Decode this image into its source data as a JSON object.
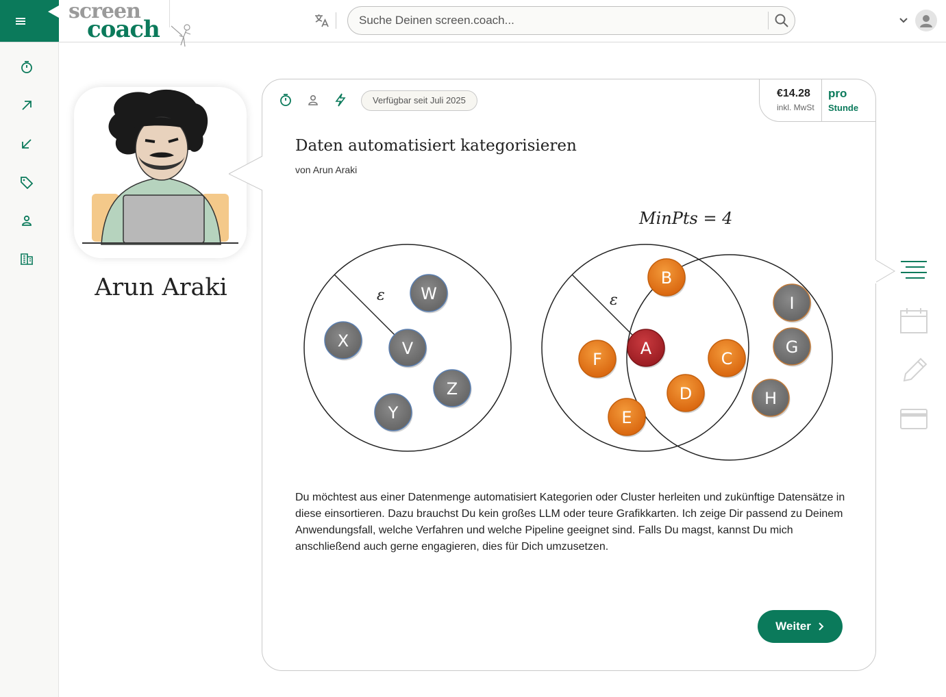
{
  "header": {
    "logo_line1": "screen",
    "logo_line2": "coach",
    "search_placeholder": "Suche Deinen screen.coach...",
    "icons": [
      "menu-icon",
      "translate-icon",
      "search-icon",
      "chevron-down-icon",
      "user-avatar-icon"
    ]
  },
  "sidebar": {
    "items": [
      {
        "icon": "stopwatch-icon"
      },
      {
        "icon": "arrow-up-right-icon"
      },
      {
        "icon": "arrow-down-left-icon"
      },
      {
        "icon": "tag-icon"
      },
      {
        "icon": "person-icon"
      },
      {
        "icon": "building-icon"
      }
    ]
  },
  "coach": {
    "name": "Arun Araki"
  },
  "card": {
    "meta_icons": [
      "stopwatch-icon",
      "person-icon",
      "lightning-icon"
    ],
    "availability": "Verfügbar seit Juli 2025",
    "price": "€14.28",
    "vat": "inkl. MwSt",
    "price_label": "pro",
    "price_unit": "Stunde",
    "title": "Daten automatisiert kategorisieren",
    "author": "von Arun Araki",
    "figure": {
      "formula": "MinPts = 4",
      "epsilon": "ε",
      "left_nodes": [
        "W",
        "X",
        "V",
        "Z",
        "Y"
      ],
      "right_nodes_core": [
        "A"
      ],
      "right_nodes_orange": [
        "B",
        "F",
        "C",
        "D",
        "E"
      ],
      "right_nodes_gray": [
        "I",
        "G",
        "H"
      ]
    },
    "description": "Du möchtest aus einer Datenmenge automatisiert Kategorien oder Cluster herleiten und zukünftige Datensätze in diese einsortieren. Dazu brauchst Du kein großes LLM oder teure Grafikkarten. Ich zeige Dir passend zu Deinem Anwendungsfall, welche Verfahren und welche Pipeline geeignet sind. Falls Du magst, kannst Du mich anschließend auch gerne engagieren, dies für Dich umzusetzen.",
    "next_button": "Weiter"
  },
  "steps": [
    "description-lines-icon",
    "calendar-icon",
    "pencil-icon",
    "credit-card-icon"
  ],
  "colors": {
    "brand_green": "#0b7a5b",
    "node_gray": "#7a7a7a",
    "node_orange": "#e87a1e",
    "node_red": "#b3262b"
  }
}
